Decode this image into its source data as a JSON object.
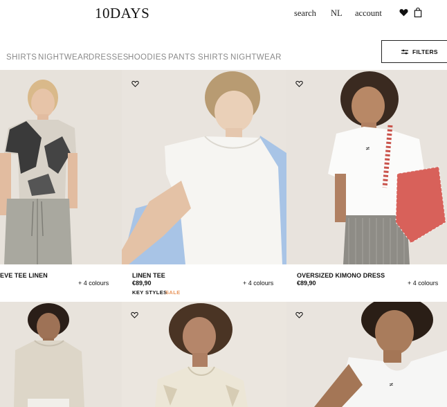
{
  "header": {
    "logo": "10DAYS",
    "search_label": "search",
    "lang_label": "NL",
    "account_label": "account",
    "wishlist_icon": "heart-icon",
    "bag_icon": "shopping-bag-icon"
  },
  "categories": [
    "SHIRTS",
    "NIGHTWEAR",
    "DRESSES",
    "HOODIES",
    "PANTS",
    "SHIRTS",
    "NIGHTWEAR"
  ],
  "filters": {
    "label": "FILTERS",
    "icon": "sliders-icon"
  },
  "products": [
    {
      "name": "EVE TEE LINEN",
      "price": "",
      "colours": "+ 4 colours",
      "tags": []
    },
    {
      "name": "LINEN TEE",
      "price": "€89,90",
      "colours": "+ 4 colours",
      "tags": [
        "KEY STYLES",
        "SALE"
      ]
    },
    {
      "name": "OVERSIZED KIMONO DRESS",
      "price": "€89,90",
      "colours": "+ 4 colours",
      "tags": []
    }
  ],
  "colors": {
    "sale": "#e8955a",
    "category_text": "#8a8a8a",
    "image_bg": "#e9e5df"
  }
}
